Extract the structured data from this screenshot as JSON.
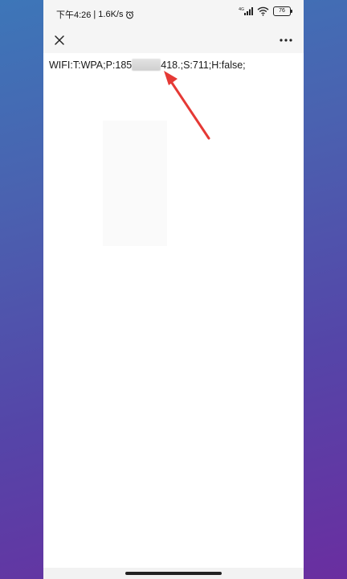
{
  "status_bar": {
    "time": "下午4:26",
    "separator": "|",
    "speed": "1.6K/s",
    "network_label": "4G",
    "battery_level": "76"
  },
  "nav": {
    "close_icon": "close-icon",
    "more_icon": "more-icon"
  },
  "content": {
    "text_start": "WIFI:T:WPA;P:185",
    "text_end": "418.;S:711;H:false;"
  },
  "colors": {
    "arrow": "#e53935",
    "page_bg": "#ffffff",
    "bar_bg": "#f5f5f5"
  }
}
